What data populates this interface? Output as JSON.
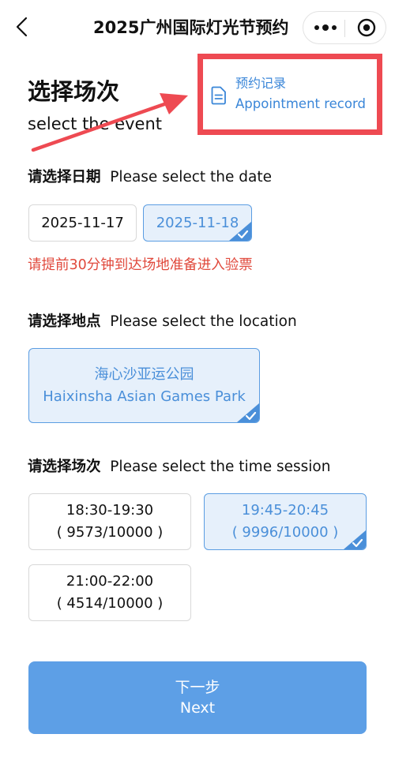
{
  "nav": {
    "title": "2025广州国际灯光节预约",
    "back_icon": "chevron-left-icon",
    "more_icon": "more-dots-icon",
    "close_icon": "target-circle-icon"
  },
  "heading": {
    "title_cn": "选择场次",
    "title_en": "select the event"
  },
  "record": {
    "label_cn": "预约记录",
    "label_en": "Appointment record",
    "icon": "document-icon",
    "color": "#3a86d8",
    "highlight_color": "#ee4a52"
  },
  "date_section": {
    "label_cn": "请选择日期",
    "label_en": "Please select the date",
    "options": [
      {
        "text": "2025-11-17",
        "selected": false
      },
      {
        "text": "2025-11-18",
        "selected": true
      }
    ],
    "notice": "请提前30分钟到达场地准备进入验票"
  },
  "location_section": {
    "label_cn": "请选择地点",
    "label_en": "Please select the location",
    "options": [
      {
        "name_cn": "海心沙亚运公园",
        "name_en": "Haixinsha Asian Games Park",
        "selected": true
      }
    ]
  },
  "session_section": {
    "label_cn": "请选择场次",
    "label_en": "Please select the time session",
    "options": [
      {
        "time": "18:30-19:30",
        "capacity": "( 9573/10000 )",
        "selected": false
      },
      {
        "time": "19:45-20:45",
        "capacity": "( 9996/10000 )",
        "selected": true
      },
      {
        "time": "21:00-22:00",
        "capacity": "( 4514/10000 )",
        "selected": false
      }
    ]
  },
  "next_button": {
    "label_cn": "下一步",
    "label_en": "Next"
  },
  "colors": {
    "accent": "#5d9fe6",
    "selected_bg": "#e6f0fb",
    "notice": "#e0483b"
  }
}
